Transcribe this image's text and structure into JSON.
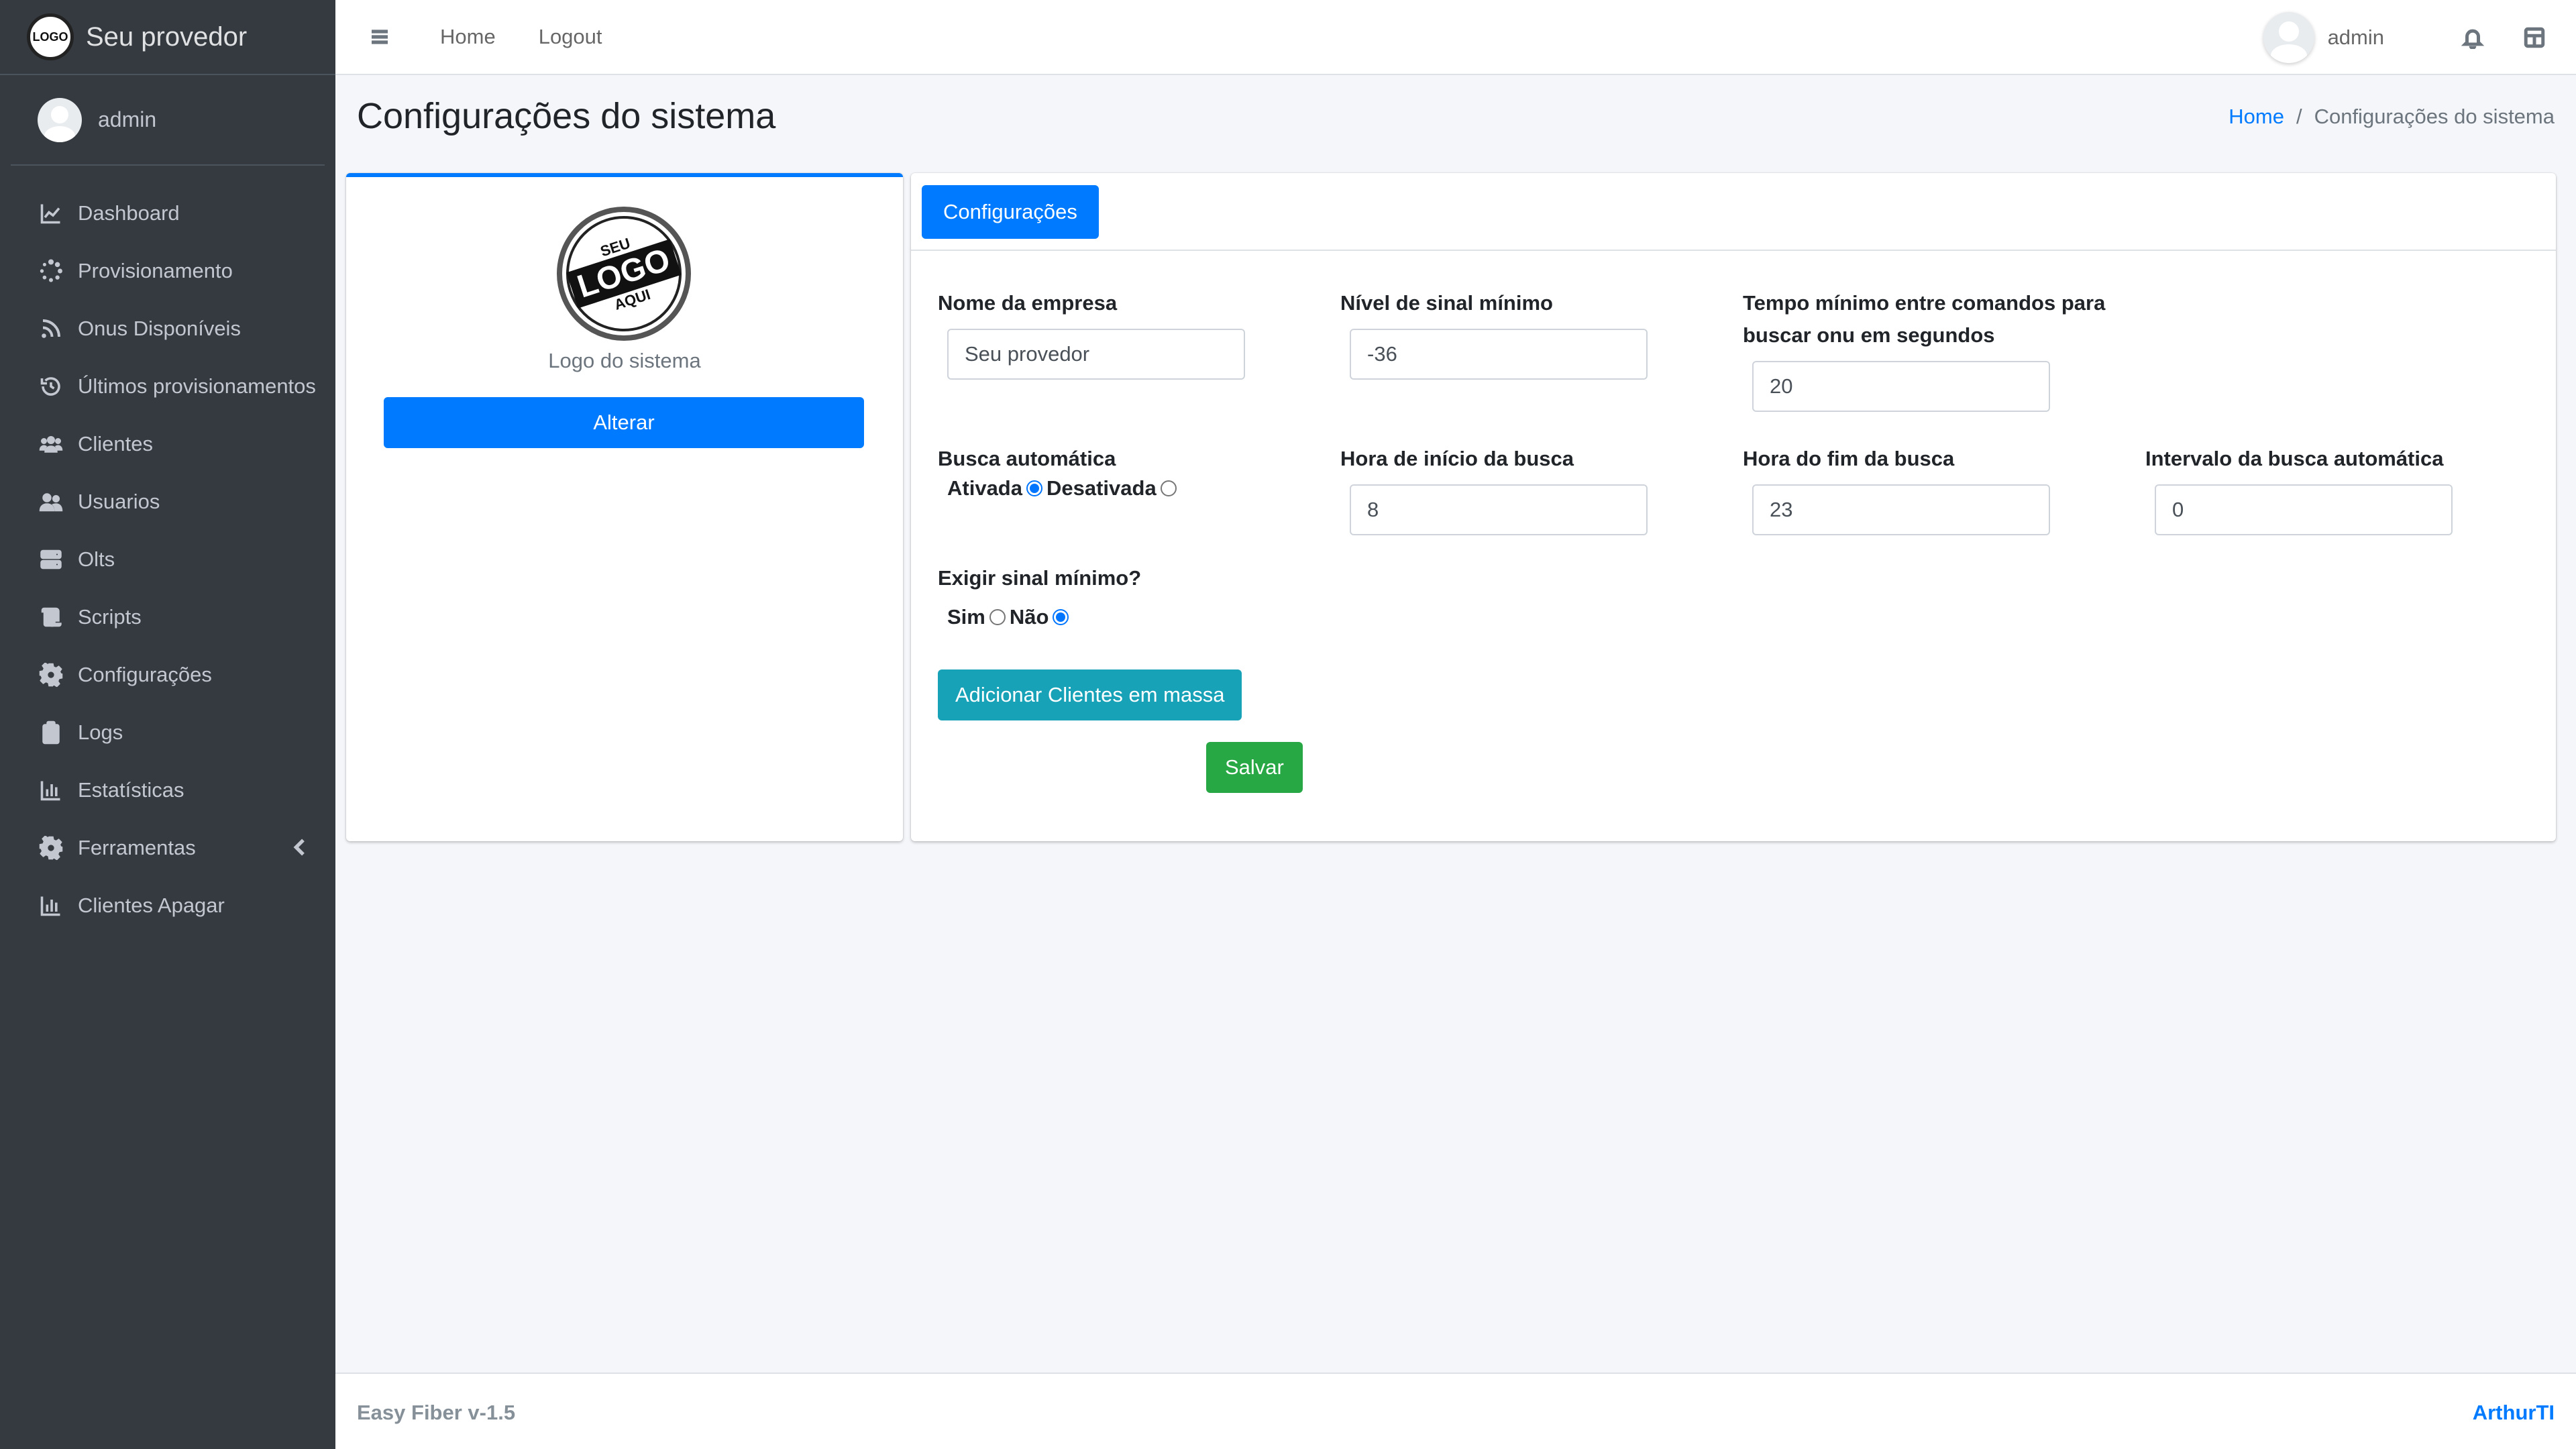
{
  "brand": {
    "name": "Seu provedor",
    "logo_text": "LOGO"
  },
  "sidebar": {
    "user": "admin",
    "items": [
      {
        "label": "Dashboard",
        "icon": "chart-line-icon"
      },
      {
        "label": "Provisionamento",
        "icon": "spinner-icon"
      },
      {
        "label": "Onus Disponíveis",
        "icon": "rss-icon"
      },
      {
        "label": "Últimos provisionamentos",
        "icon": "history-icon"
      },
      {
        "label": "Clientes",
        "icon": "users-icon"
      },
      {
        "label": "Usuarios",
        "icon": "user-friends-icon"
      },
      {
        "label": "Olts",
        "icon": "server-icon"
      },
      {
        "label": "Scripts",
        "icon": "scroll-icon"
      },
      {
        "label": "Configurações",
        "icon": "gear-icon"
      },
      {
        "label": "Logs",
        "icon": "clipboard-icon"
      },
      {
        "label": "Estatísticas",
        "icon": "chart-bar-icon"
      },
      {
        "label": "Ferramentas",
        "icon": "gear-icon"
      },
      {
        "label": "Clientes Apagar",
        "icon": "chart-bar-icon"
      }
    ]
  },
  "topbar": {
    "home": "Home",
    "logout": "Logout",
    "username": "admin"
  },
  "page": {
    "title": "Configurações do sistema",
    "breadcrumb_home": "Home",
    "breadcrumb_current": "Configurações do sistema"
  },
  "logo_card": {
    "logo_top": "SEU",
    "logo_main": "LOGO",
    "logo_bottom": "AQUI",
    "caption": "Logo do sistema",
    "button": "Alterar"
  },
  "config": {
    "tab": "Configurações",
    "company_name_label": "Nome da empresa",
    "company_name_value": "Seu provedor",
    "min_signal_label": "Nível de sinal mínimo",
    "min_signal_value": "-36",
    "min_time_label_1": "Tempo mínimo entre comandos para",
    "min_time_label_2": "buscar onu em segundos",
    "min_time_value": "20",
    "auto_search_label": "Busca automática",
    "auto_on": "Ativada",
    "auto_off": "Desativada",
    "start_hour_label": "Hora de início da busca",
    "start_hour_value": "8",
    "end_hour_label": "Hora do fim da busca",
    "end_hour_value": "23",
    "interval_label": "Intervalo da busca automática",
    "interval_value": "0",
    "require_signal_label": "Exigir sinal mínimo?",
    "yes": "Sim",
    "no": "Não",
    "bulk_button": "Adicionar Clientes em massa",
    "save_button": "Salvar"
  },
  "footer": {
    "version": "Easy Fiber v-1.5",
    "author": "ArthurTI"
  }
}
